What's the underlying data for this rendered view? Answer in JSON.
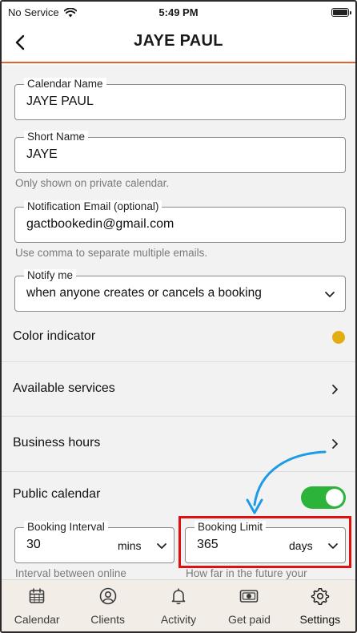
{
  "status_bar": {
    "carrier": "No Service",
    "time": "5:49 PM"
  },
  "header": {
    "title": "JAYE PAUL"
  },
  "form": {
    "calendar_name": {
      "label": "Calendar Name",
      "value": "JAYE PAUL"
    },
    "short_name": {
      "label": "Short Name",
      "value": "JAYE",
      "helper": "Only shown on private calendar."
    },
    "notification_email": {
      "label": "Notification Email (optional)",
      "value": "gactbookedin@gmail.com",
      "helper": "Use comma to separate multiple emails."
    },
    "notify_me": {
      "label": "Notify me",
      "value": "when anyone creates or cancels a booking"
    },
    "color_indicator": {
      "label": "Color indicator",
      "color": "#e3ad12"
    },
    "available_services": {
      "label": "Available services"
    },
    "business_hours": {
      "label": "Business hours"
    },
    "public_calendar": {
      "label": "Public calendar",
      "enabled": true
    },
    "booking_interval": {
      "label": "Booking Interval",
      "value": "30",
      "unit": "mins",
      "helper": "Interval between online"
    },
    "booking_limit": {
      "label": "Booking Limit",
      "value": "365",
      "unit": "days",
      "helper": "How far in the future your"
    }
  },
  "tabs": [
    {
      "label": "Calendar",
      "icon": "calendar-icon"
    },
    {
      "label": "Clients",
      "icon": "person-icon"
    },
    {
      "label": "Activity",
      "icon": "bell-icon"
    },
    {
      "label": "Get paid",
      "icon": "money-icon"
    },
    {
      "label": "Settings",
      "icon": "gear-icon",
      "active": true
    }
  ],
  "colors": {
    "accent": "#e6622a",
    "toggle_on": "#2bb33a",
    "highlight": "#e01010",
    "arrow": "#1e9be6"
  }
}
